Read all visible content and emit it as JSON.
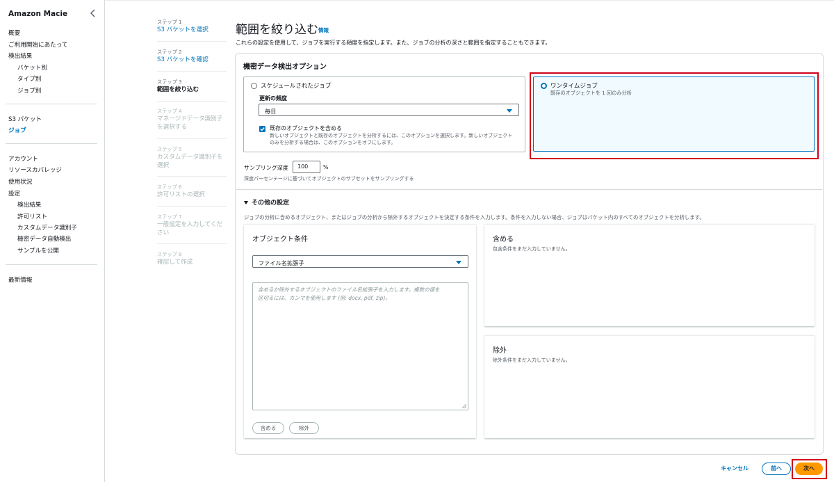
{
  "app": {
    "title": "Amazon Macie"
  },
  "sidebar": {
    "group1": [
      {
        "label": "概要"
      },
      {
        "label": "ご利用開始にあたって"
      },
      {
        "label": "検出結果"
      }
    ],
    "findings_sub": [
      {
        "label": "バケット別"
      },
      {
        "label": "タイプ別"
      },
      {
        "label": "ジョブ別"
      }
    ],
    "group2": [
      {
        "label": "S3 バケット"
      },
      {
        "label": "ジョブ"
      }
    ],
    "group3": [
      {
        "label": "アカウント"
      },
      {
        "label": "リソースカバレッジ"
      },
      {
        "label": "使用状況"
      },
      {
        "label": "設定"
      }
    ],
    "settings_sub": [
      {
        "label": "検出結果"
      },
      {
        "label": "許可リスト"
      },
      {
        "label": "カスタムデータ識別子"
      },
      {
        "label": "機密データ自動検出"
      },
      {
        "label": "サンプルを公開"
      }
    ],
    "group4": [
      {
        "label": "最新情報"
      }
    ]
  },
  "steps": [
    {
      "num": "ステップ 1",
      "label": "S3 バケットを選択"
    },
    {
      "num": "ステップ 2",
      "label": "S3 バケットを確認"
    },
    {
      "num": "ステップ 3",
      "label": "範囲を絞り込む"
    },
    {
      "num": "ステップ 4",
      "label": "マネージドデータ識別子を選択する"
    },
    {
      "num": "ステップ 5",
      "label": "カスタムデータ識別子を選択"
    },
    {
      "num": "ステップ 6",
      "label": "許可リストの選択"
    },
    {
      "num": "ステップ 7",
      "label": "一般設定を入力してください"
    },
    {
      "num": "ステップ 8",
      "label": "確認して作成"
    }
  ],
  "header": {
    "title": "範囲を絞り込む",
    "info": "情報",
    "description": "これらの設定を使用して、ジョブを実行する頻度を指定します。また、ジョブの分析の深さと範囲を指定することもできます。"
  },
  "detection": {
    "section_title": "機密データ検出オプション",
    "scheduled": {
      "title": "スケジュールされたジョブ",
      "selected": false,
      "frequency_label": "更新の頻度",
      "frequency_value": "毎日",
      "include_existing_checked": true,
      "include_existing_title": "既存のオブジェクトを含める",
      "include_existing_desc_1": "新しいオブジェクトと既存のオブジェクトを分析するには、このオプションを選択します。新しいオブジェクト",
      "include_existing_desc_2": "のみを分析する場合は、このオプションをオフにします。"
    },
    "onetime": {
      "title": "ワンタイムジョブ",
      "subtitle": "既存のオブジェクトを 1 回のみ分析",
      "selected": true
    },
    "sampling": {
      "label": "サンプリング深度",
      "value": "100",
      "unit": "%",
      "hint": "深度パーセンテージに基づいてオブジェクトのサブセットをサンプリングする"
    }
  },
  "other": {
    "title": "その他の設定",
    "description": "ジョブの分析に含めるオブジェクト、またはジョブの分析から除外するオブジェクトを決定する条件を入力します。条件を入力しない場合、ジョブはバケット内のすべてのオブジェクトを分析します。",
    "object_criteria": {
      "title": "オブジェクト条件",
      "select_value": "ファイル名拡張子",
      "textarea_placeholder_1": "含めるか除外するオブジェクトのファイル名拡張子を入力します。複数の値を",
      "textarea_placeholder_2": "区切るには、カンマを使用します (例: docx, pdf, zip)。",
      "include_button": "含める",
      "exclude_button": "除外"
    },
    "include_panel": {
      "title": "含める",
      "empty": "包含条件をまだ入力していません。"
    },
    "exclude_panel": {
      "title": "除外",
      "empty": "除外条件をまだ入力していません。"
    }
  },
  "footer": {
    "cancel": "キャンセル",
    "prev": "前へ",
    "next": "次へ"
  },
  "colors": {
    "link": "#0073bb",
    "primary_button": "#ff9900",
    "highlight": "#d0021b",
    "selected_card_bg": "#f1faff"
  }
}
